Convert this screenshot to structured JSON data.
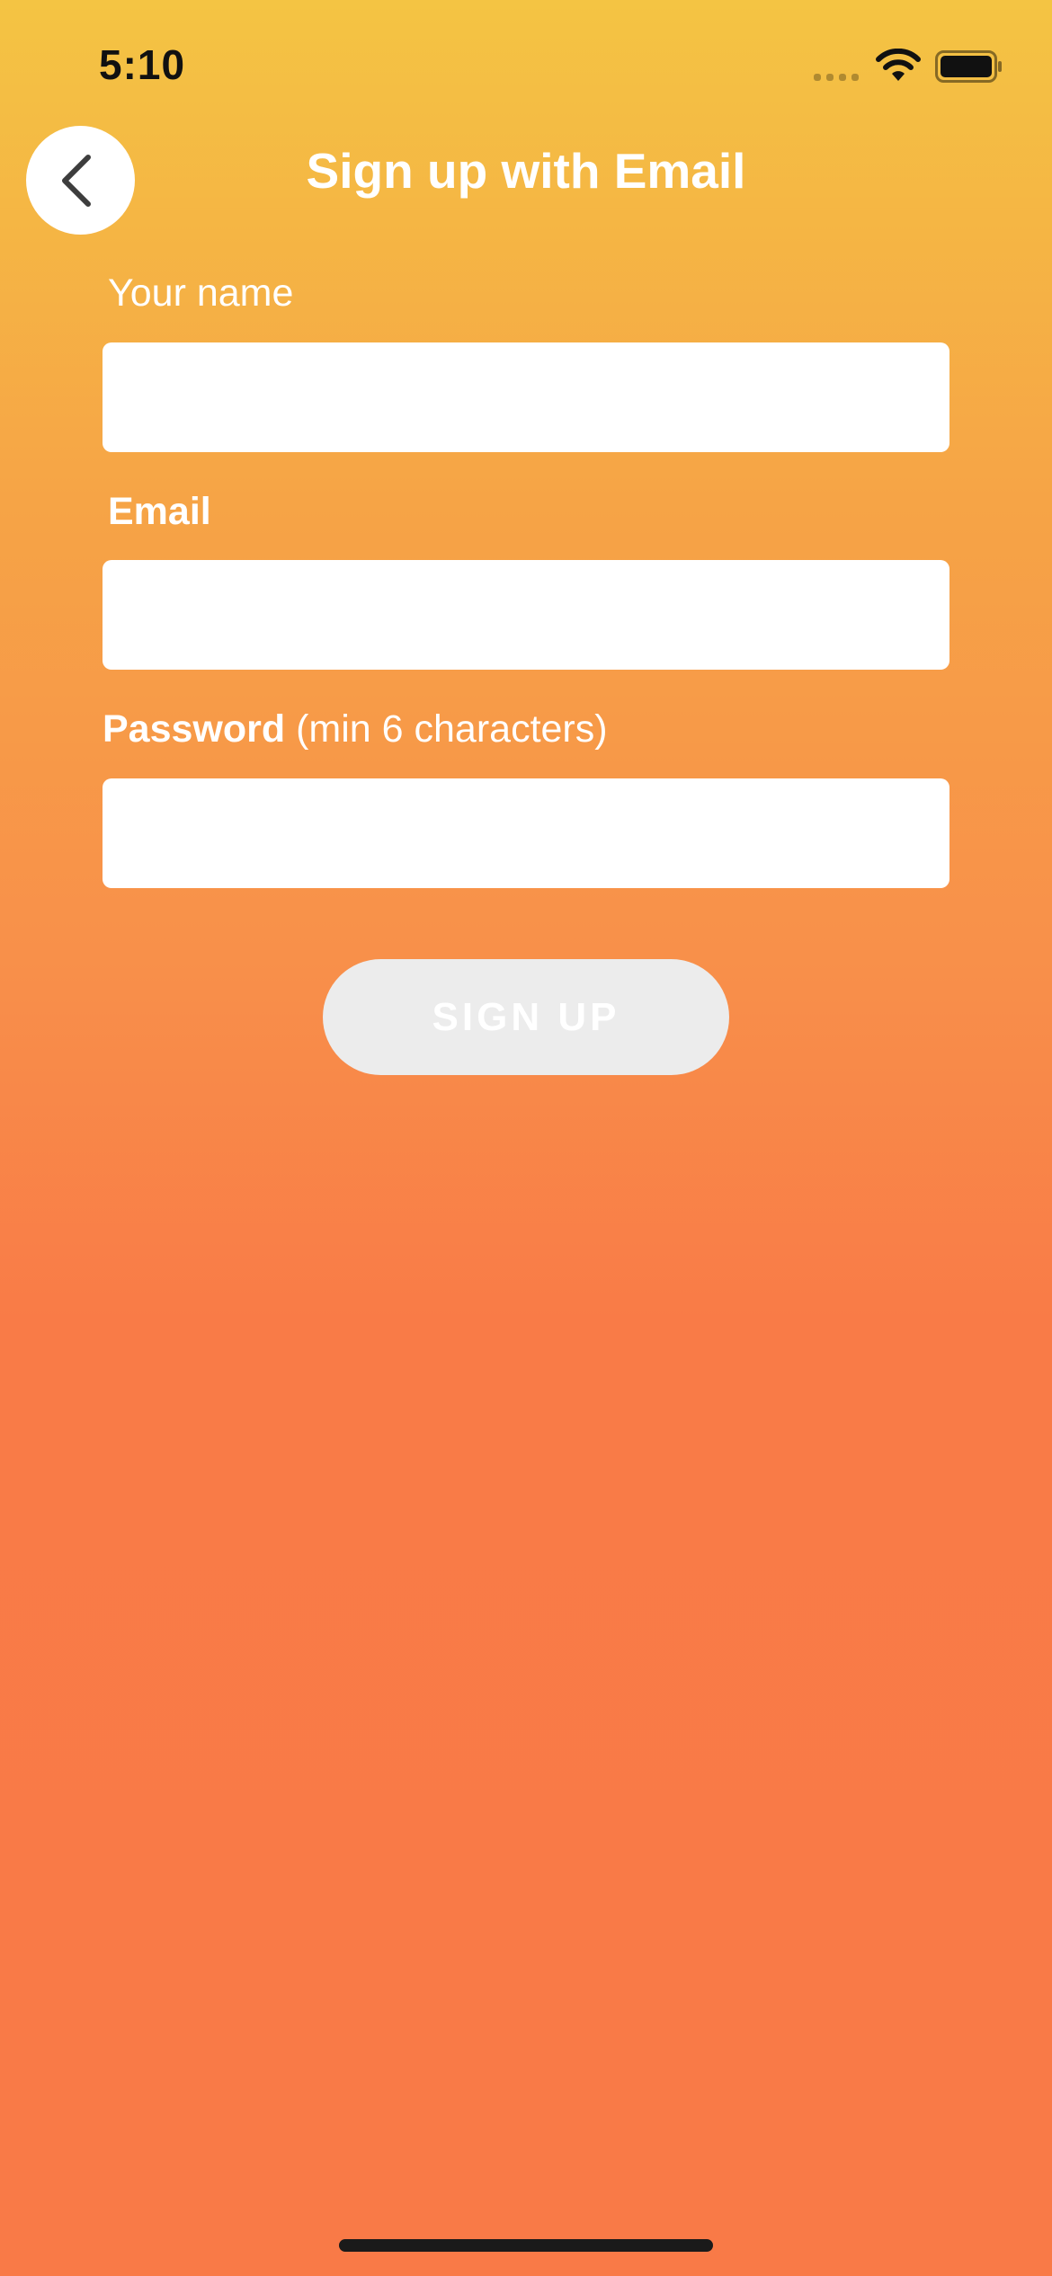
{
  "status_bar": {
    "time": "5:10",
    "icons": [
      "cellular-signal-icon",
      "wifi-icon",
      "battery-icon"
    ]
  },
  "header": {
    "back_icon": "chevron-left-icon",
    "title": "Sign up with Email"
  },
  "form": {
    "name_label": "Your name",
    "name_value": "",
    "email_label": "Email",
    "email_value": "",
    "password_label_bold": "Password",
    "password_label_hint": "(min 6 characters)",
    "password_value": ""
  },
  "actions": {
    "signup_label": "SIGN UP"
  },
  "colors": {
    "gradient_top": "#f4c443",
    "gradient_bottom": "#f97a47",
    "button_disabled": "#ececec"
  }
}
